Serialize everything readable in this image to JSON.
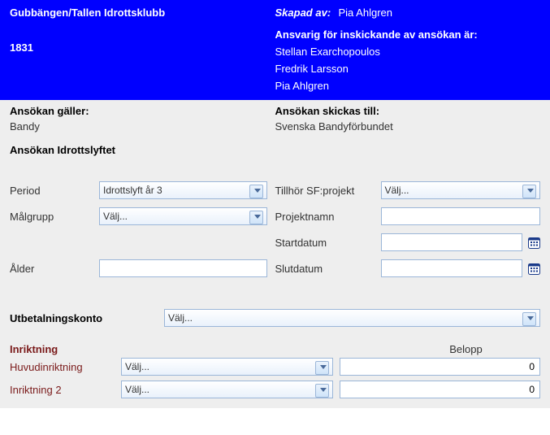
{
  "header": {
    "club_name": "Gubbängen/Tallen Idrottsklubb",
    "club_number": "1831",
    "skapad_label": "Skapad av:",
    "skapad_value": "Pia Ahlgren",
    "ansvarig_label": "Ansvarig för inskickande av ansökan är:",
    "responsible": [
      "Stellan Exarchopoulos",
      "Fredrik Larsson",
      "Pia Ahlgren"
    ]
  },
  "info": {
    "galler_label": "Ansökan gäller:",
    "galler_value": "Bandy",
    "skickas_label": "Ansökan skickas till:",
    "skickas_value": "Svenska Bandyförbundet",
    "section_title": "Ansökan Idrottslyftet"
  },
  "form": {
    "period_label": "Period",
    "period_value": "Idrottslyft år 3",
    "malgrupp_label": "Målgrupp",
    "malgrupp_value": "Välj...",
    "alder_label": "Ålder",
    "alder_value": "",
    "sfprojekt_label": "Tillhör SF:projekt",
    "sfprojekt_value": "Välj...",
    "projektnamn_label": "Projektnamn",
    "projektnamn_value": "",
    "startdatum_label": "Startdatum",
    "startdatum_value": "",
    "slutdatum_label": "Slutdatum",
    "slutdatum_value": ""
  },
  "utbetalning": {
    "label": "Utbetalningskonto",
    "value": "Välj..."
  },
  "inriktning": {
    "title": "Inriktning",
    "belopp_label": "Belopp",
    "rows": [
      {
        "label": "Huvudinriktning",
        "select": "Välj...",
        "amount": "0"
      },
      {
        "label": "Inriktning 2",
        "select": "Välj...",
        "amount": "0"
      }
    ]
  }
}
